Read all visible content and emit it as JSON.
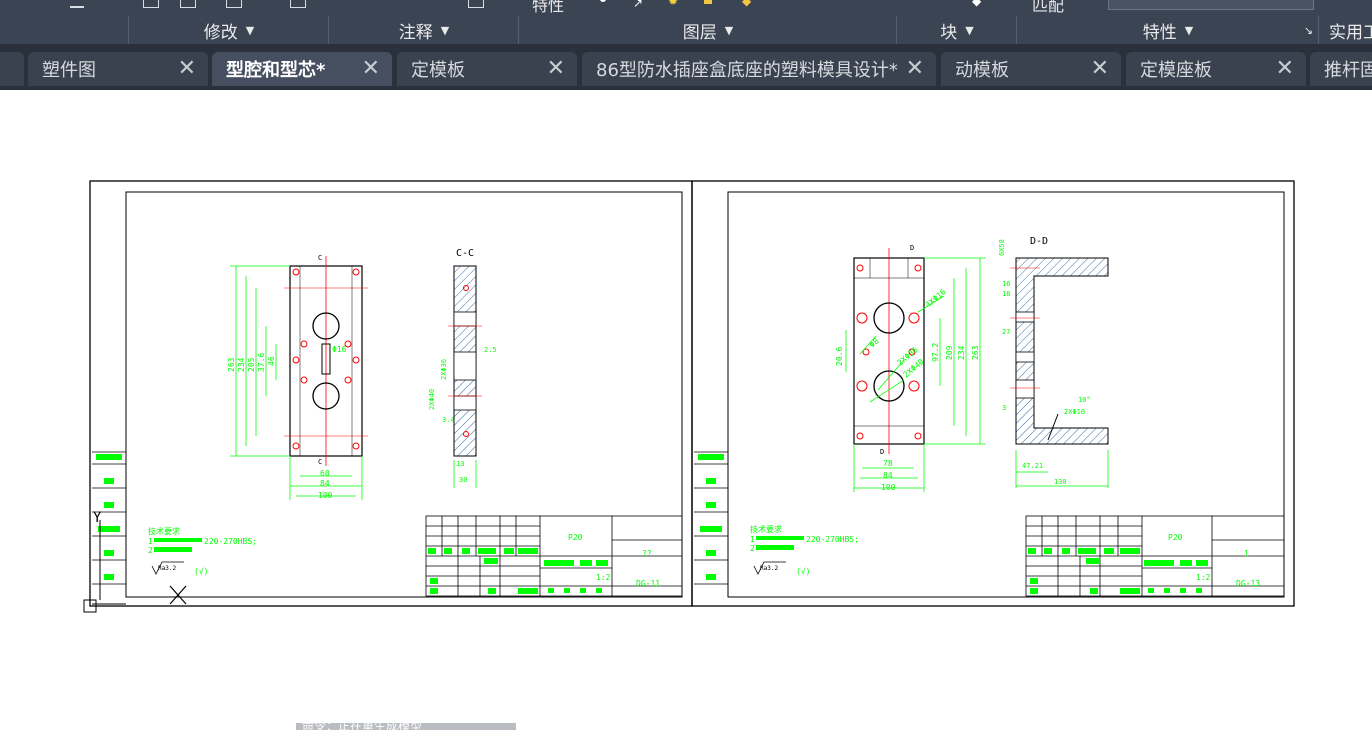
{
  "ribbon": {
    "top_labels": {
      "properties": "特性",
      "match": "匹配"
    },
    "panels": [
      {
        "label": "修改"
      },
      {
        "label": "注释"
      },
      {
        "label": "图层"
      },
      {
        "label": "块"
      },
      {
        "label": "特性"
      },
      {
        "label": "实用工"
      }
    ]
  },
  "tabs": [
    {
      "label": "塑件图",
      "active": false
    },
    {
      "label": "型腔和型芯*",
      "active": true
    },
    {
      "label": "定模板",
      "active": false
    },
    {
      "label": "86型防水插座盒底座的塑料模具设计*",
      "active": false
    },
    {
      "label": "动模板",
      "active": false
    },
    {
      "label": "定模座板",
      "active": false
    },
    {
      "label": "推杆固",
      "active": false
    }
  ],
  "drawing_left": {
    "section_label": "C-C",
    "view_marks": [
      "C",
      "C"
    ],
    "dims_bottom": [
      "60",
      "84",
      "100"
    ],
    "dims_left": [
      "263",
      "234",
      "205",
      "37.6",
      "46"
    ],
    "dims_note": "Φ16",
    "section_dims": [
      "2.5",
      "2XΦ36",
      "2XΦ40",
      "3.4",
      "13",
      "30"
    ],
    "tech_title": "技术要求",
    "tech_note": "220-270HBS;",
    "tech_line_numbers": [
      "1",
      "2"
    ],
    "roughness": "Ra3.2",
    "roughness_paren": "(√)",
    "title_material": "P20",
    "title_qty": "??",
    "title_scale": "1:2",
    "title_number": "DG-11"
  },
  "drawing_right": {
    "section_label": "D-D",
    "view_marks": [
      "D",
      "D"
    ],
    "dims_bottom": [
      "78",
      "84",
      "100"
    ],
    "dims_left": [
      "20.6",
      "97.2",
      "209",
      "234",
      "263"
    ],
    "hole_notes": [
      "4XΦ16",
      "2XΦ36",
      "2XΦ40",
      "Φ8"
    ],
    "section_dims": [
      "6X58",
      "16",
      "18",
      "27",
      "3",
      "10°",
      "2XΦ10",
      "47.21",
      "130"
    ],
    "tech_title": "技术要求",
    "tech_note": "220-270HBS;",
    "tech_line_numbers": [
      "1",
      "2"
    ],
    "roughness": "Ra3.2",
    "roughness_paren": "(√)",
    "title_material": "P20",
    "title_qty": "1",
    "title_scale": "1:2",
    "title_number": "DG-13"
  },
  "ucs_label": "Y",
  "command_line": "命令：正在重生成模型",
  "colors": {
    "ribbon_bg": "#3b4453",
    "tab_bg": "#2a313c",
    "cad_green": "#00ff00",
    "cad_red": "#ff0000",
    "hatch": "#3a6ea5"
  }
}
